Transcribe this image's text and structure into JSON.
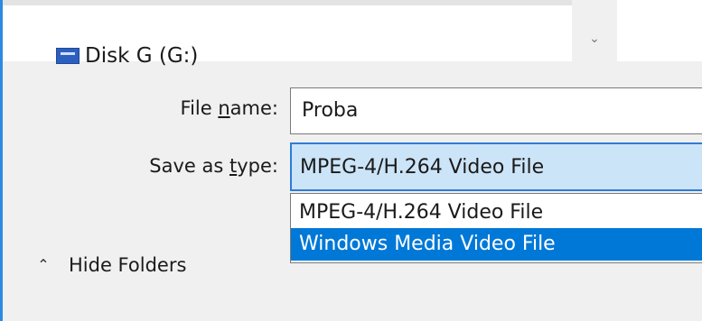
{
  "tree": {
    "drive_label": "Disk G (G:)"
  },
  "fields": {
    "file_name_label_pre": "File ",
    "file_name_label_u": "n",
    "file_name_label_post": "ame:",
    "file_name_value": "Proba",
    "save_type_label_pre": "Save as ",
    "save_type_label_u": "t",
    "save_type_label_post": "ype:",
    "save_type_selected": "MPEG-4/H.264 Video File"
  },
  "dropdown": {
    "options": [
      "MPEG-4/H.264 Video File",
      "Windows Media Video File"
    ],
    "highlighted_index": 1
  },
  "footer": {
    "hide_folders_label": "Hide Folders"
  },
  "colors": {
    "accent": "#0078d7",
    "select_bg": "#cce4f7"
  },
  "icons": {
    "drive": "drive-icon",
    "scroll_down": "chevron-down-icon",
    "hide_folders": "chevron-up-icon"
  }
}
